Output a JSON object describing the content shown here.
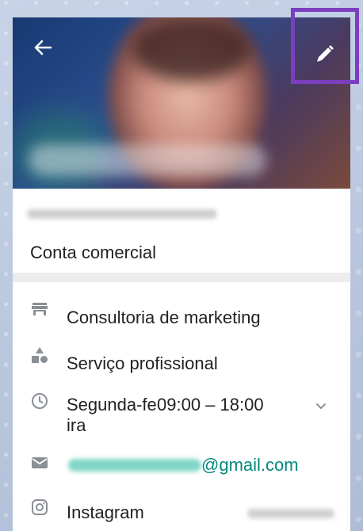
{
  "header": {
    "back_icon": "arrow-left-icon",
    "edit_icon": "pencil-icon",
    "highlight_color": "#7b3fbe"
  },
  "account": {
    "type_label": "Conta comercial"
  },
  "details": {
    "category": {
      "icon": "store-icon",
      "label": "Consultoria de marketing"
    },
    "service": {
      "icon": "category-shapes-icon",
      "label": "Serviço profissional"
    },
    "hours": {
      "icon": "clock-icon",
      "day_line1": "Segunda-fe",
      "day_line2": "ira",
      "time": "09:00 – 18:00",
      "expand_icon": "chevron-down-icon"
    },
    "email": {
      "icon": "mail-icon",
      "domain": "@gmail.com"
    },
    "instagram": {
      "icon": "instagram-icon",
      "label": "Instagram"
    }
  },
  "colors": {
    "accent": "#00897b",
    "icon_gray": "#8a8f94"
  }
}
